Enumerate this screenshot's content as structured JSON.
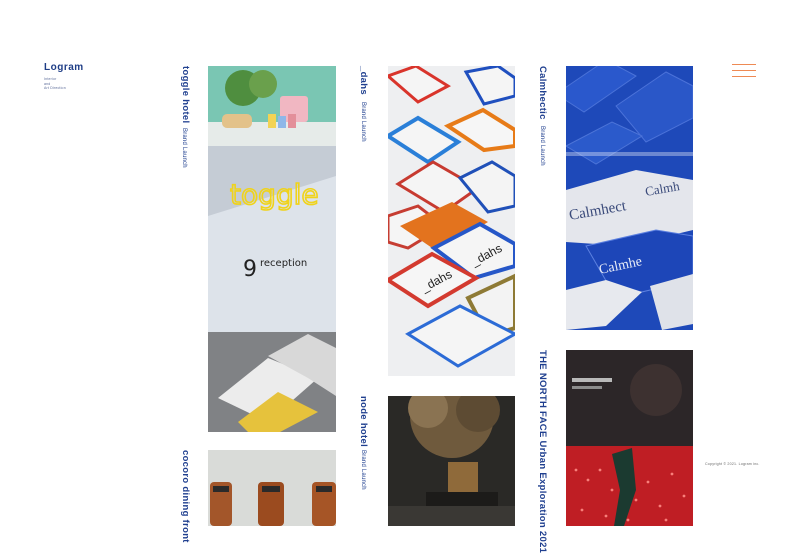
{
  "site": {
    "logo": "Logram",
    "tagline": [
      "Interior",
      "and",
      "Art Direction"
    ],
    "copyright": "Copyright © 2021. Logram inc."
  },
  "colors": {
    "accent": "#ee8a54",
    "text": "#1f3f8f"
  },
  "menu": {
    "icon": "hamburger-menu-icon"
  },
  "projects": [
    {
      "title": "toggle hotel",
      "category": "Brand Launch",
      "art_text": [
        "toggle",
        "reception",
        "9"
      ]
    },
    {
      "title": "cocoro dining front",
      "category": ""
    },
    {
      "title": "_dahs",
      "category": "Brand Launch",
      "art_text": [
        "_dahs"
      ]
    },
    {
      "title": "node hotel",
      "category": "Brand Launch"
    },
    {
      "title": "Calmhectic",
      "category": "Brand Launch",
      "art_text": [
        "Calmhect",
        "Calmhectic",
        "Calmhe",
        "Calmh"
      ]
    },
    {
      "title": "THE NORTH FACE Urban Exploration 2021",
      "category": ""
    }
  ]
}
